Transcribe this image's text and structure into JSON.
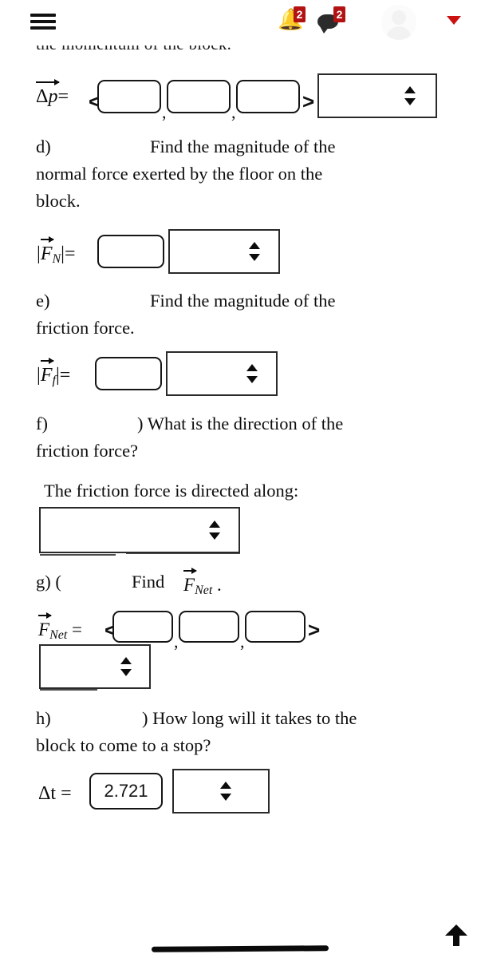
{
  "header": {
    "menu_icon": "hamburger-menu-icon",
    "notifications": {
      "icon": "bell-icon",
      "count": "2"
    },
    "messages": {
      "icon": "chat-bubble-icon",
      "count": "2"
    },
    "avatar_icon": "user-avatar-icon",
    "account_caret_icon": "caret-down-icon",
    "badge_color": "#b21212",
    "caret_color": "#cc1111"
  },
  "content": {
    "cutoff_line": "the momentum of the block.",
    "delta_p": {
      "label_delta": "Δ",
      "label_p": "p",
      "equals": "=",
      "open_bracket": "<",
      "close_bracket": ">",
      "comma": ",",
      "x_value": "",
      "y_value": "",
      "z_value": "",
      "unit_value": ""
    },
    "part_d": {
      "letter": "d)",
      "line1": "Find the magnitude of the",
      "line2": "normal force exerted by the floor on the",
      "line3": "block."
    },
    "f_normal": {
      "bar_left": "|",
      "label_F": "F",
      "label_sub": "N",
      "bar_right": "|",
      "equals": "=",
      "value": "",
      "unit_value": ""
    },
    "part_e": {
      "letter": "e)",
      "line1": "Find the magnitude of the",
      "line2": "friction force."
    },
    "f_friction": {
      "bar_left": "|",
      "label_F": "F",
      "label_sub": "f",
      "bar_right": "|",
      "equals": "=",
      "value": "",
      "unit_value": ""
    },
    "part_f": {
      "letter": "f)",
      "line1": ") What is the direction of the",
      "line2": "friction force?",
      "prompt": "The friction force is directed along:",
      "direction_value": ""
    },
    "part_g": {
      "letter": "g) (",
      "prompt_find": "Find ",
      "label_F": "F",
      "label_sub": "Net",
      "period": ".",
      "equals": "=",
      "open_bracket": "<",
      "close_bracket": ">",
      "comma": ",",
      "x_value": "",
      "y_value": "",
      "z_value": "",
      "unit_value": ""
    },
    "part_h": {
      "letter": "h)",
      "line1": ") How long will it takes to the",
      "line2": "block to come to a stop?",
      "delta_t_label": "Δt",
      "equals": "=",
      "delta_t_value": "2.721",
      "unit_value": ""
    }
  },
  "footer": {
    "scroll_top_icon": "arrow-up-icon",
    "home_indicator": "home-indicator"
  }
}
